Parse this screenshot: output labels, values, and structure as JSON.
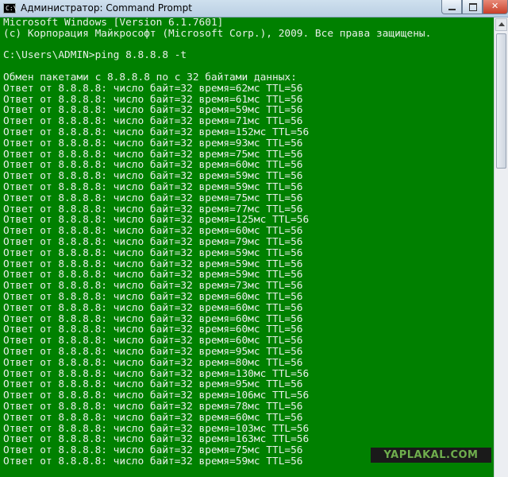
{
  "window": {
    "title": "Администратор: Command Prompt",
    "icon": "console-icon",
    "icon_glyph": "C:\\"
  },
  "console": {
    "lines": [
      "Microsoft Windows [Version 6.1.7601]",
      "(c) Корпорация Майкрософт (Microsoft Corp.), 2009. Все права защищены.",
      "",
      "C:\\Users\\ADMIN>ping 8.8.8.8 -t",
      "",
      "Обмен пакетами с 8.8.8.8 по с 32 байтами данных:",
      "Ответ от 8.8.8.8: число байт=32 время=62мс TTL=56",
      "Ответ от 8.8.8.8: число байт=32 время=61мс TTL=56",
      "Ответ от 8.8.8.8: число байт=32 время=59мс TTL=56",
      "Ответ от 8.8.8.8: число байт=32 время=71мс TTL=56",
      "Ответ от 8.8.8.8: число байт=32 время=152мс TTL=56",
      "Ответ от 8.8.8.8: число байт=32 время=93мс TTL=56",
      "Ответ от 8.8.8.8: число байт=32 время=75мс TTL=56",
      "Ответ от 8.8.8.8: число байт=32 время=60мс TTL=56",
      "Ответ от 8.8.8.8: число байт=32 время=59мс TTL=56",
      "Ответ от 8.8.8.8: число байт=32 время=59мс TTL=56",
      "Ответ от 8.8.8.8: число байт=32 время=75мс TTL=56",
      "Ответ от 8.8.8.8: число байт=32 время=77мс TTL=56",
      "Ответ от 8.8.8.8: число байт=32 время=125мс TTL=56",
      "Ответ от 8.8.8.8: число байт=32 время=60мс TTL=56",
      "Ответ от 8.8.8.8: число байт=32 время=79мс TTL=56",
      "Ответ от 8.8.8.8: число байт=32 время=59мс TTL=56",
      "Ответ от 8.8.8.8: число байт=32 время=59мс TTL=56",
      "Ответ от 8.8.8.8: число байт=32 время=59мс TTL=56",
      "Ответ от 8.8.8.8: число байт=32 время=73мс TTL=56",
      "Ответ от 8.8.8.8: число байт=32 время=60мс TTL=56",
      "Ответ от 8.8.8.8: число байт=32 время=60мс TTL=56",
      "Ответ от 8.8.8.8: число байт=32 время=60мс TTL=56",
      "Ответ от 8.8.8.8: число байт=32 время=60мс TTL=56",
      "Ответ от 8.8.8.8: число байт=32 время=60мс TTL=56",
      "Ответ от 8.8.8.8: число байт=32 время=95мс TTL=56",
      "Ответ от 8.8.8.8: число байт=32 время=80мс TTL=56",
      "Ответ от 8.8.8.8: число байт=32 время=130мс TTL=56",
      "Ответ от 8.8.8.8: число байт=32 время=95мс TTL=56",
      "Ответ от 8.8.8.8: число байт=32 время=106мс TTL=56",
      "Ответ от 8.8.8.8: число байт=32 время=78мс TTL=56",
      "Ответ от 8.8.8.8: число байт=32 время=60мс TTL=56",
      "Ответ от 8.8.8.8: число байт=32 время=103мс TTL=56",
      "Ответ от 8.8.8.8: число байт=32 время=163мс TTL=56",
      "Ответ от 8.8.8.8: число байт=32 время=75мс TTL=56",
      "Ответ от 8.8.8.8: число байт=32 время=59мс TTL=56"
    ]
  },
  "watermark": "YAPLAKAL.COM",
  "colors": {
    "console_bg": "#008000",
    "console_text": "#e8f0e8",
    "watermark_text": "#6fae4d"
  }
}
